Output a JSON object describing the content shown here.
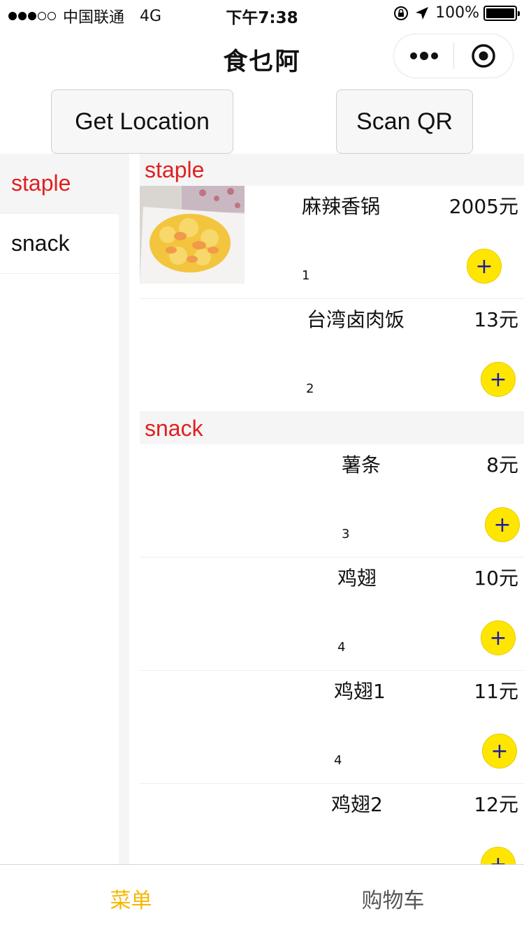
{
  "status_bar": {
    "carrier": "中国联通",
    "network": "4G",
    "time": "下午7:38",
    "battery": "100%",
    "battery_level": 1.0
  },
  "nav": {
    "title": "食乜阿"
  },
  "actions": {
    "get_location": "Get Location",
    "scan_qr": "Scan QR"
  },
  "sidebar": {
    "items": [
      {
        "label": "staple",
        "active": true
      },
      {
        "label": "snack",
        "active": false
      }
    ]
  },
  "menu": {
    "categories": [
      {
        "header": "staple",
        "dishes": [
          {
            "name": "麻辣香锅",
            "price": "2005元",
            "num": "1",
            "has_image": true
          },
          {
            "name": "台湾卤肉饭",
            "price": "13元",
            "num": "2"
          }
        ]
      },
      {
        "header": "snack",
        "dishes": [
          {
            "name": "薯条",
            "price": "8元",
            "num": "3"
          },
          {
            "name": "鸡翅",
            "price": "10元",
            "num": "4"
          },
          {
            "name": "鸡翅1",
            "price": "11元",
            "num": "4"
          },
          {
            "name": "鸡翅2",
            "price": "12元",
            "num": ""
          }
        ]
      }
    ],
    "add_symbol": "+"
  },
  "tabs": [
    {
      "label": "菜单",
      "active": true
    },
    {
      "label": "购物车",
      "active": false
    }
  ],
  "colors": {
    "accent": "#e02020",
    "add_button": "#ffe600",
    "tab_active": "#f5b800"
  }
}
